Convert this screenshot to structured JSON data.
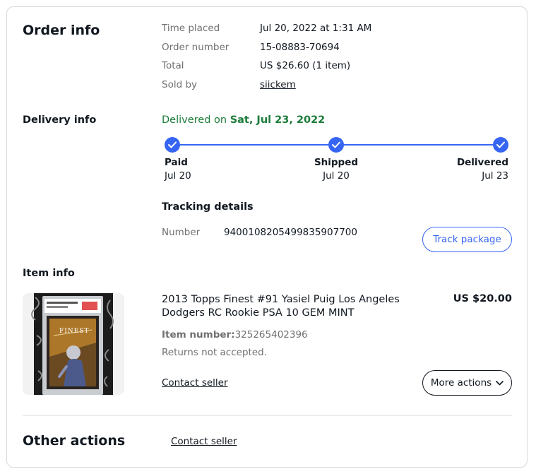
{
  "order_info": {
    "title": "Order info",
    "rows": [
      {
        "label": "Time placed",
        "value": "Jul 20, 2022 at 1:31 AM"
      },
      {
        "label": "Order number",
        "value": "15-08883-70694"
      },
      {
        "label": "Total",
        "value": "US $26.60 (1 item)"
      },
      {
        "label": "Sold by",
        "value": "siickem"
      }
    ]
  },
  "delivery_info": {
    "title": "Delivery info",
    "status_prefix": "Delivered on ",
    "status_date": "Sat, Jul 23, 2022",
    "steps": [
      {
        "name": "Paid",
        "date": "Jul 20"
      },
      {
        "name": "Shipped",
        "date": "Jul 20"
      },
      {
        "name": "Delivered",
        "date": "Jul 23"
      }
    ],
    "tracking_title": "Tracking details",
    "number_label": "Number",
    "number_value": "9400108205499835907700",
    "track_button": "Track package"
  },
  "item_info": {
    "title": "Item info",
    "item_title": "2013 Topps Finest #91 Yasiel Puig Los Angeles Dodgers RC Rookie PSA 10 GEM MINT",
    "price": "US $20.00",
    "item_number_label": "Item number:",
    "item_number_value": "325265402396",
    "returns": "Returns not accepted.",
    "contact_seller": "Contact seller",
    "more_actions": "More actions"
  },
  "other_actions": {
    "title": "Other actions",
    "contact_seller": "Contact seller"
  },
  "colors": {
    "accent": "#3665f3",
    "delivered_green": "#1c7d3a",
    "muted_text": "#707070"
  }
}
